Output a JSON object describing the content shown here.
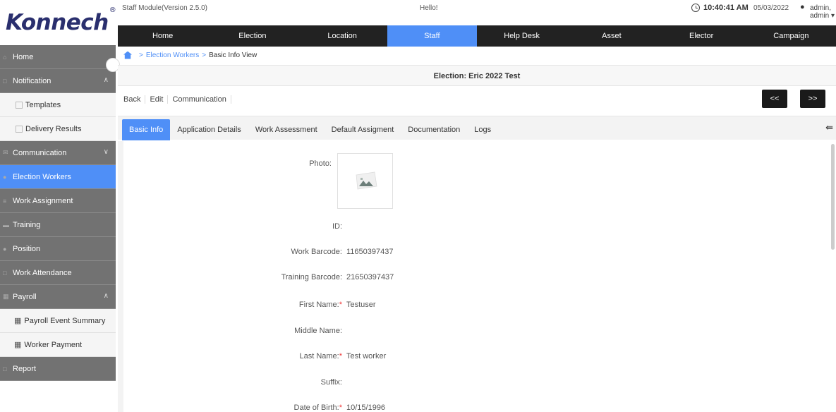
{
  "app": {
    "logo": "Konnech",
    "logo_mark": "®",
    "version": "Staff Module(Version 2.5.0)",
    "greeting": "Hello!",
    "time": "10:40:41 AM",
    "date": "05/03/2022",
    "user": "admin, admin ▾"
  },
  "nav": {
    "items": [
      "Home",
      "Election",
      "Location",
      "Staff",
      "Help Desk",
      "Asset",
      "Elector",
      "Campaign"
    ],
    "active": "Staff"
  },
  "sidebar": {
    "home": "Home",
    "notification": "Notification",
    "templates": "Templates",
    "delivery_results": "Delivery Results",
    "communication": "Communication",
    "election_workers": "Election Workers",
    "work_assignment": "Work Assignment",
    "training": "Training",
    "position": "Position",
    "work_attendance": "Work Attendance",
    "payroll": "Payroll",
    "payroll_event_summary": "Payroll Event Summary",
    "worker_payment": "Worker Payment",
    "report": "Report"
  },
  "breadcrumb": {
    "sep1": ">",
    "link": "Election Workers",
    "sep2": ">",
    "current": "Basic Info View"
  },
  "election_title": "Election: Eric 2022 Test",
  "actions": {
    "back": "Back",
    "edit": "Edit",
    "communication": "Communication",
    "prev": "<<",
    "next": ">>"
  },
  "tabs": {
    "basic_info": "Basic Info",
    "application_details": "Application Details",
    "work_assessment": "Work Assessment",
    "default_assignment": "Default Assigment",
    "documentation": "Documentation",
    "logs": "Logs",
    "toggle": "⇚"
  },
  "form": {
    "photo_label": "Photo:",
    "id_label": "ID:",
    "id_value": "",
    "work_barcode_label": "Work Barcode:",
    "work_barcode_value": "11650397437",
    "training_barcode_label": "Training Barcode:",
    "training_barcode_value": "21650397437",
    "first_name_label": "First Name:",
    "first_name_value": "Testuser",
    "middle_name_label": "Middle Name:",
    "middle_name_value": "",
    "last_name_label": "Last Name:",
    "last_name_value": "Test worker",
    "suffix_label": "Suffix:",
    "suffix_value": "",
    "dob_label": "Date of Birth:",
    "dob_value": "10/15/1996",
    "required_mark": "*"
  },
  "colors": {
    "accent": "#4f8ff7",
    "nav_bg": "#222222",
    "sidebar_bg": "#727272",
    "logo": "#2a2f6e",
    "required": "#ee3333"
  }
}
